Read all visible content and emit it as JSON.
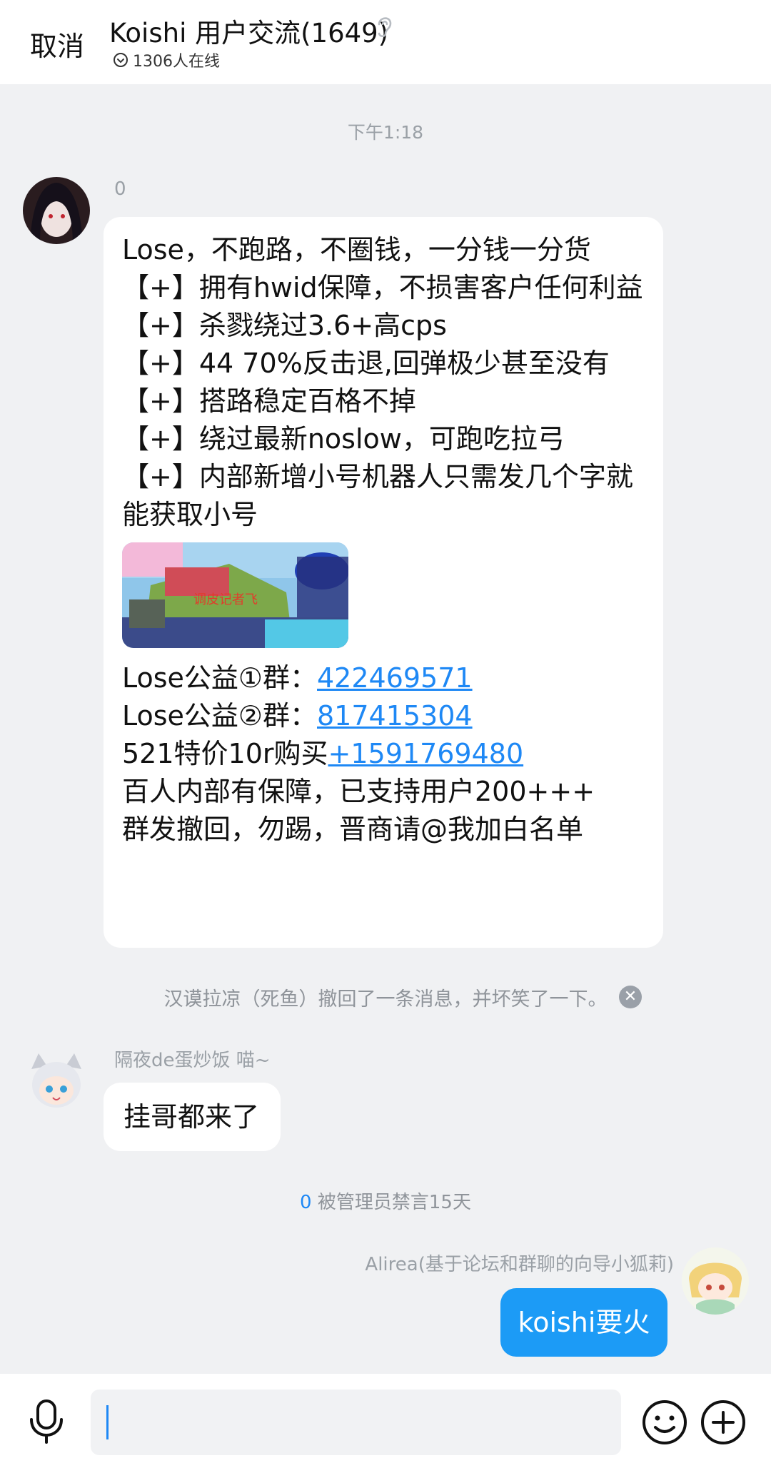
{
  "header": {
    "cancel_label": "取消",
    "title": "Koishi 用户交流(1649)",
    "online_text": "1306人在线"
  },
  "timestamp": "下午1:18",
  "messages": [
    {
      "sender": "0",
      "lines": [
        "Lose，不跑路，不圈钱，一分钱一分货",
        "【+】拥有hwid保障，不损害客户任何利益",
        "【+】杀戮绕过3.6+高cps",
        "【+】44 70%反击退,回弹极少甚至没有",
        "【+】搭路稳定百格不掉",
        "【+】绕过最新noslow，可跑吃拉弓",
        "【+】内部新增小号机器人只需发几个字就能获取小号"
      ],
      "group1_prefix": "Lose公益①群：",
      "group1_link": "422469571",
      "group2_prefix": "Lose公益②群：",
      "group2_link": "817415304",
      "price_prefix": "521特价10r购买",
      "price_link": "+1591769480",
      "tail_lines": [
        "百人内部有保障，已支持用户200+++",
        "群发撤回，勿踢，晋商请@我加白名单"
      ],
      "thumbnail_text": "调皮记者飞"
    },
    {
      "sender": "隔夜de蛋炒饭 喵~",
      "text": "挂哥都来了"
    },
    {
      "sender": "Alirea(基于论坛和群聊的向导小狐莉)",
      "text": "koishi要火"
    }
  ],
  "system": {
    "recall_notice": "汉谟拉凉（死鱼）撤回了一条消息，并坏笑了一下。",
    "ban_user": "0",
    "ban_text": " 被管理员禁言15天"
  },
  "input": {
    "value": "",
    "placeholder": ""
  },
  "colors": {
    "link": "#1e88f5",
    "self_bubble": "#1c9bf6",
    "background": "#f0f1f3"
  },
  "icons": [
    "ear-icon",
    "online-status-icon",
    "close-icon",
    "microphone-icon",
    "emoji-icon",
    "plus-icon"
  ]
}
